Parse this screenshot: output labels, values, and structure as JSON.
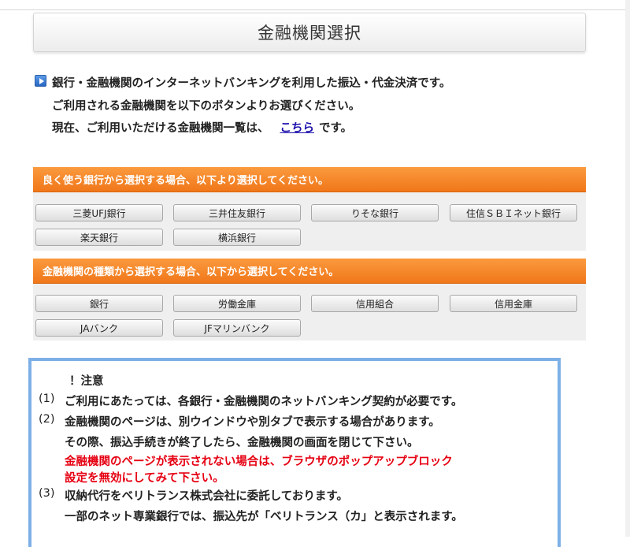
{
  "page": {
    "title": "金融機関選択"
  },
  "intro": {
    "line1": "銀行・金融機関のインターネットバンキングを利用した振込・代金決済です。",
    "line2": "ご利用される金融機関を以下のボタンよりお選びください。",
    "line3_prefix": "現在、ご利用いただける金融機関一覧は、",
    "link_label": "こちら",
    "line3_suffix": "です。"
  },
  "frequent_banks": {
    "heading": "良く使う銀行から選択する場合、以下より選択してください。",
    "buttons": [
      "三菱UFJ銀行",
      "三井住友銀行",
      "りそな銀行",
      "住信ＳＢＩネット銀行",
      "楽天銀行",
      "横浜銀行"
    ]
  },
  "institution_types": {
    "heading": "金融機関の種類から選択する場合、以下から選択してください。",
    "buttons": [
      "銀行",
      "労働金庫",
      "信用組合",
      "信用金庫",
      "JAバンク",
      "JFマリンバンク"
    ]
  },
  "notice": {
    "title": "！注意",
    "item1_num": "(1)",
    "item1": "ご利用にあたっては、各銀行・金融機関のネットバンキング契約が必要です。",
    "item2_num": "(2)",
    "item2_line1": "金融機関のページは、別ウインドウや別タブで表示する場合があります。",
    "item2_line2": "その際、振込手続きが終了したら、金融機関の画面を閉じて下さい。",
    "item2_warning1": "金融機関のページが表示されない場合は、ブラウザのポップアップブロック",
    "item2_warning2": "設定を無効にしてみて下さい。",
    "item3_num": "(3)",
    "item3_line1": "収納代行をベリトランス株式会社に委託しております。",
    "item3_line2": "一部のネット専業銀行では、振込先が「ベリトランス（カ」と表示されます。"
  }
}
